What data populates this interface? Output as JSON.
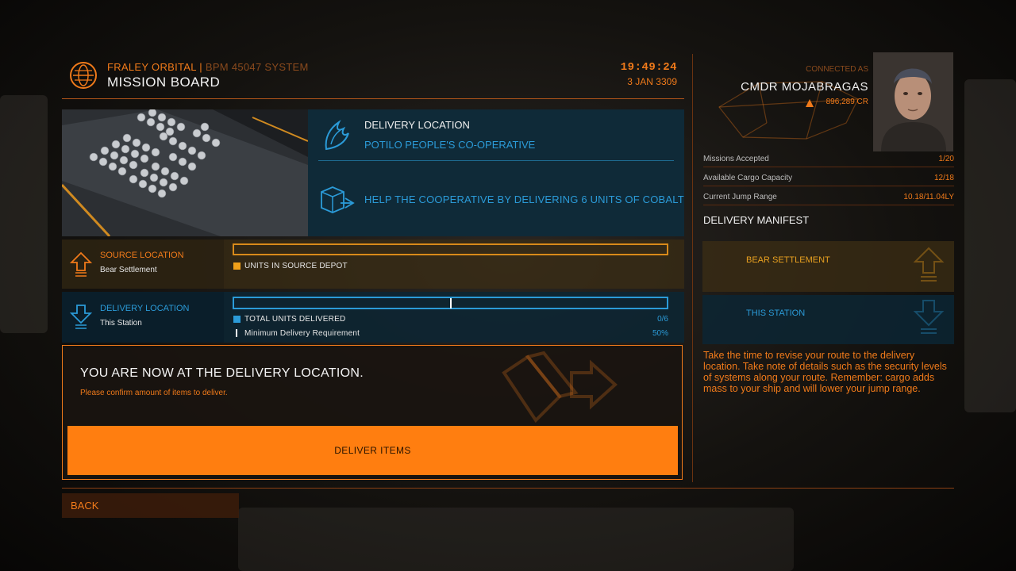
{
  "header": {
    "station": "FRALEY ORBITAL",
    "separator": "|",
    "system": "BPM 45047 SYSTEM",
    "title": "MISSION BOARD",
    "time": "19:49:24",
    "date": "3 JAN 3309"
  },
  "mission": {
    "delivery_label": "DELIVERY LOCATION",
    "faction": "POTILO PEOPLE'S CO-OPERATIVE",
    "description": "HELP THE COOPERATIVE BY DELIVERING 6 UNITS OF COBALT"
  },
  "source": {
    "title": "SOURCE LOCATION",
    "name": "Bear Settlement",
    "legend": "UNITS IN SOURCE DEPOT"
  },
  "destination": {
    "title": "DELIVERY LOCATION",
    "name": "This Station",
    "legend_delivered": "TOTAL UNITS DELIVERED",
    "delivered_value": "0/6",
    "legend_minimum": "Minimum Delivery Requirement",
    "minimum_value": "50%",
    "minimum_fraction": 0.5
  },
  "prompt": {
    "title": "YOU ARE NOW AT THE DELIVERY LOCATION.",
    "subtitle": "Please confirm amount of items to deliver.",
    "button": "DELIVER ITEMS"
  },
  "nav": {
    "back": "BACK"
  },
  "commander": {
    "connected_as": "CONNECTED AS",
    "name": "CMDR MOJABRAGAS",
    "credits": "896,289 CR"
  },
  "stats": [
    {
      "label": "Missions Accepted",
      "value": "1/20"
    },
    {
      "label": "Available Cargo Capacity",
      "value": "12/18"
    },
    {
      "label": "Current Jump Range",
      "value": "10.18/11.04LY"
    }
  ],
  "manifest": {
    "title": "DELIVERY MANIFEST",
    "source": "BEAR SETTLEMENT",
    "destination": "THIS STATION"
  },
  "tip": "Take the time to revise your route to the delivery location. Take note of details such as the security levels of systems along your route. Remember: cargo adds mass to your ship and will lower your jump range.",
  "colors": {
    "accent": "#f07a1a",
    "blue": "#2b9bd8",
    "button": "#ff7e10"
  }
}
